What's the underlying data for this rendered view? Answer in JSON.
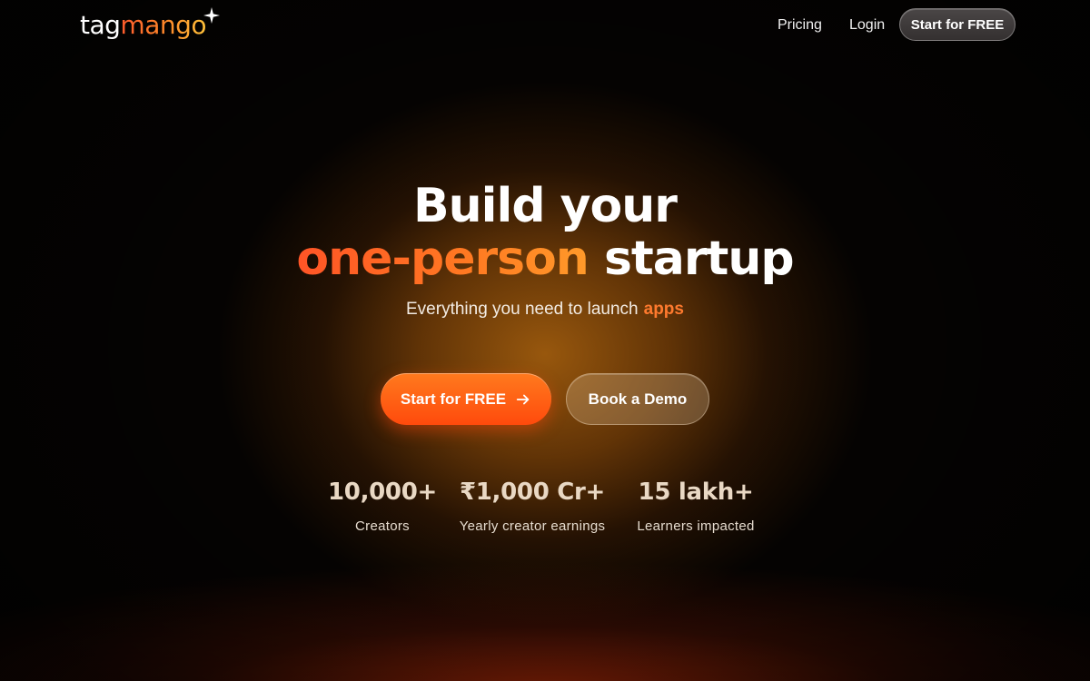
{
  "brand": {
    "logo_part1": "tag",
    "logo_part2": "mango",
    "logo_icon": "sparkle-icon"
  },
  "nav": {
    "links": [
      "Pricing",
      "Login"
    ],
    "cta_label": "Start for FREE"
  },
  "hero": {
    "title_line1": "Build your",
    "title_accent": "one-person",
    "title_rest": "startup",
    "subtitle_prefix": "Everything you need to launch",
    "subtitle_rotating_word": "apps",
    "primary_cta": "Start for FREE",
    "primary_cta_icon": "arrow-right-icon",
    "secondary_cta": "Book a Demo"
  },
  "stats": [
    {
      "value": "10,000+",
      "label": "Creators"
    },
    {
      "value": "₹1,000 Cr+",
      "label": "Yearly creator earnings"
    },
    {
      "value": "15 lakh+",
      "label": "Learners impacted"
    }
  ],
  "colors": {
    "accent": "#ff6a1f",
    "accent_dark": "#ff4a0c",
    "background": "#050302",
    "glow": "#a05c0e"
  }
}
